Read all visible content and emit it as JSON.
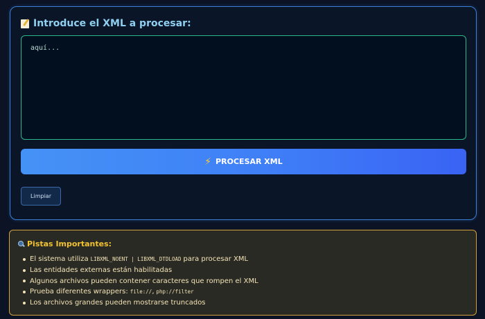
{
  "form": {
    "title": "Introduce el XML a procesar:",
    "title_icon": "memo-icon",
    "textarea_placeholder": "aquí...",
    "process_button_label": "PROCESAR XML",
    "process_button_icon": "lightning-icon",
    "clear_button_label": "Limpiar"
  },
  "hints": {
    "title": "Pistas Importantes:",
    "title_icon": "magnifier-icon",
    "items": [
      {
        "pre": "El sistema utiliza",
        "code": "LIBXML_NOENT | LIBXML_DTDLOAD",
        "post": "para procesar XML"
      },
      {
        "pre": "Las entidades externas están habilitadas",
        "code": "",
        "post": ""
      },
      {
        "pre": "Algunos archivos pueden contener caracteres que rompen el XML",
        "code": "",
        "post": ""
      },
      {
        "pre": "Prueba diferentes wrappers:",
        "code": "file://",
        "post": ",",
        "code2": "php://filter"
      },
      {
        "pre": "Los archivos grandes pueden mostrarse truncados",
        "code": "",
        "post": ""
      }
    ]
  },
  "colors": {
    "background": "#0b1324",
    "panel_border": "#3b82d6",
    "textarea_border": "#2bb98a",
    "button_gradient_start": "#4592f6",
    "button_gradient_end": "#3a63f4",
    "hints_border": "#d4a23a",
    "hints_title": "#f1c232"
  }
}
